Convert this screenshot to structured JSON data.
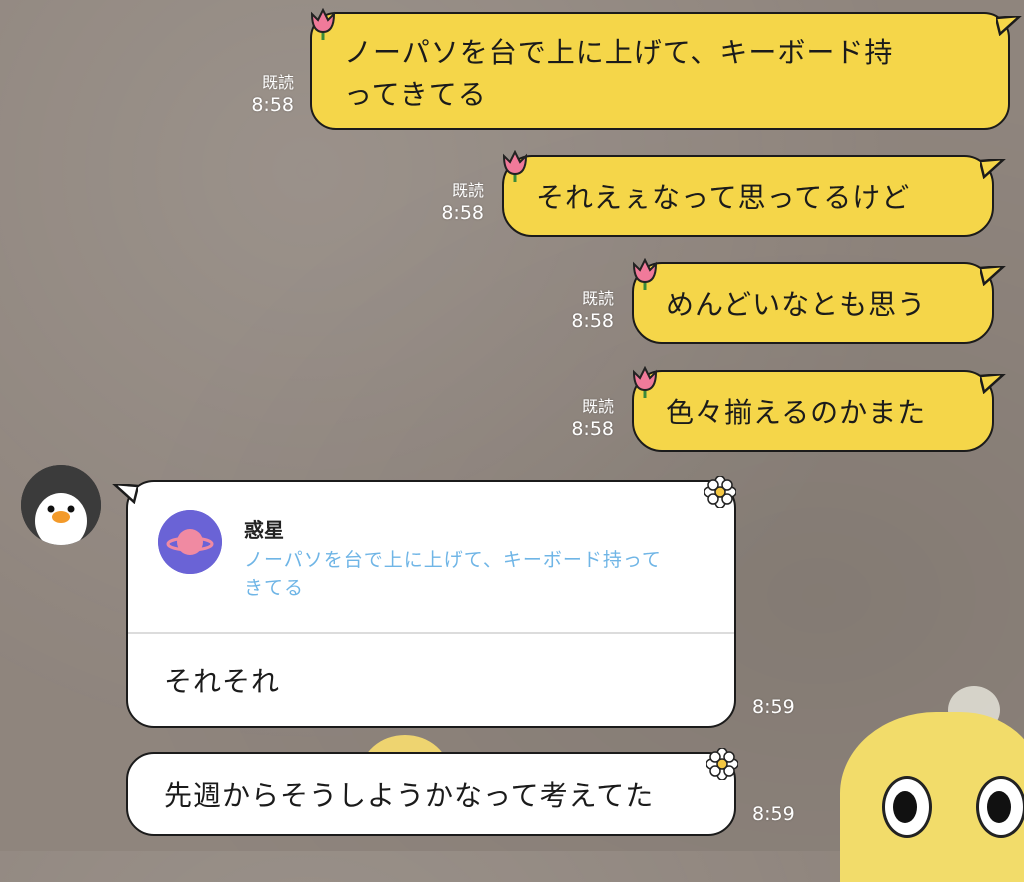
{
  "outgoing": [
    {
      "text": "ノーパソを台で上に上げて、キーボード持ってきてる",
      "line1": "ノーパソを台で上に上げて、キーボード持",
      "line2": "ってきてる",
      "read": "既読",
      "time": "8:58"
    },
    {
      "text": "それえぇなって思ってるけど",
      "read": "既読",
      "time": "8:58"
    },
    {
      "text": "めんどいなとも思う",
      "read": "既読",
      "time": "8:58"
    },
    {
      "text": "色々揃えるのかまた",
      "read": "既読",
      "time": "8:58"
    }
  ],
  "incoming": [
    {
      "reply": {
        "name": "惑星",
        "quote_line1": "ノーパソを台で上に上げて、キーボード持って",
        "quote_line2": "きてる"
      },
      "text": "それそれ",
      "time": "8:59"
    },
    {
      "text": "先週からそうしようかなって考えてた",
      "time": "8:59"
    }
  ],
  "colors": {
    "outgoing_bubble": "#f5d649",
    "incoming_bubble": "#ffffff",
    "reply_quote": "#6fb5e6",
    "planet_icon": "#6a63d6"
  },
  "icons": [
    "tulip-sticker-icon",
    "daisy-sticker-icon",
    "planet-icon",
    "penguin-avatar"
  ]
}
